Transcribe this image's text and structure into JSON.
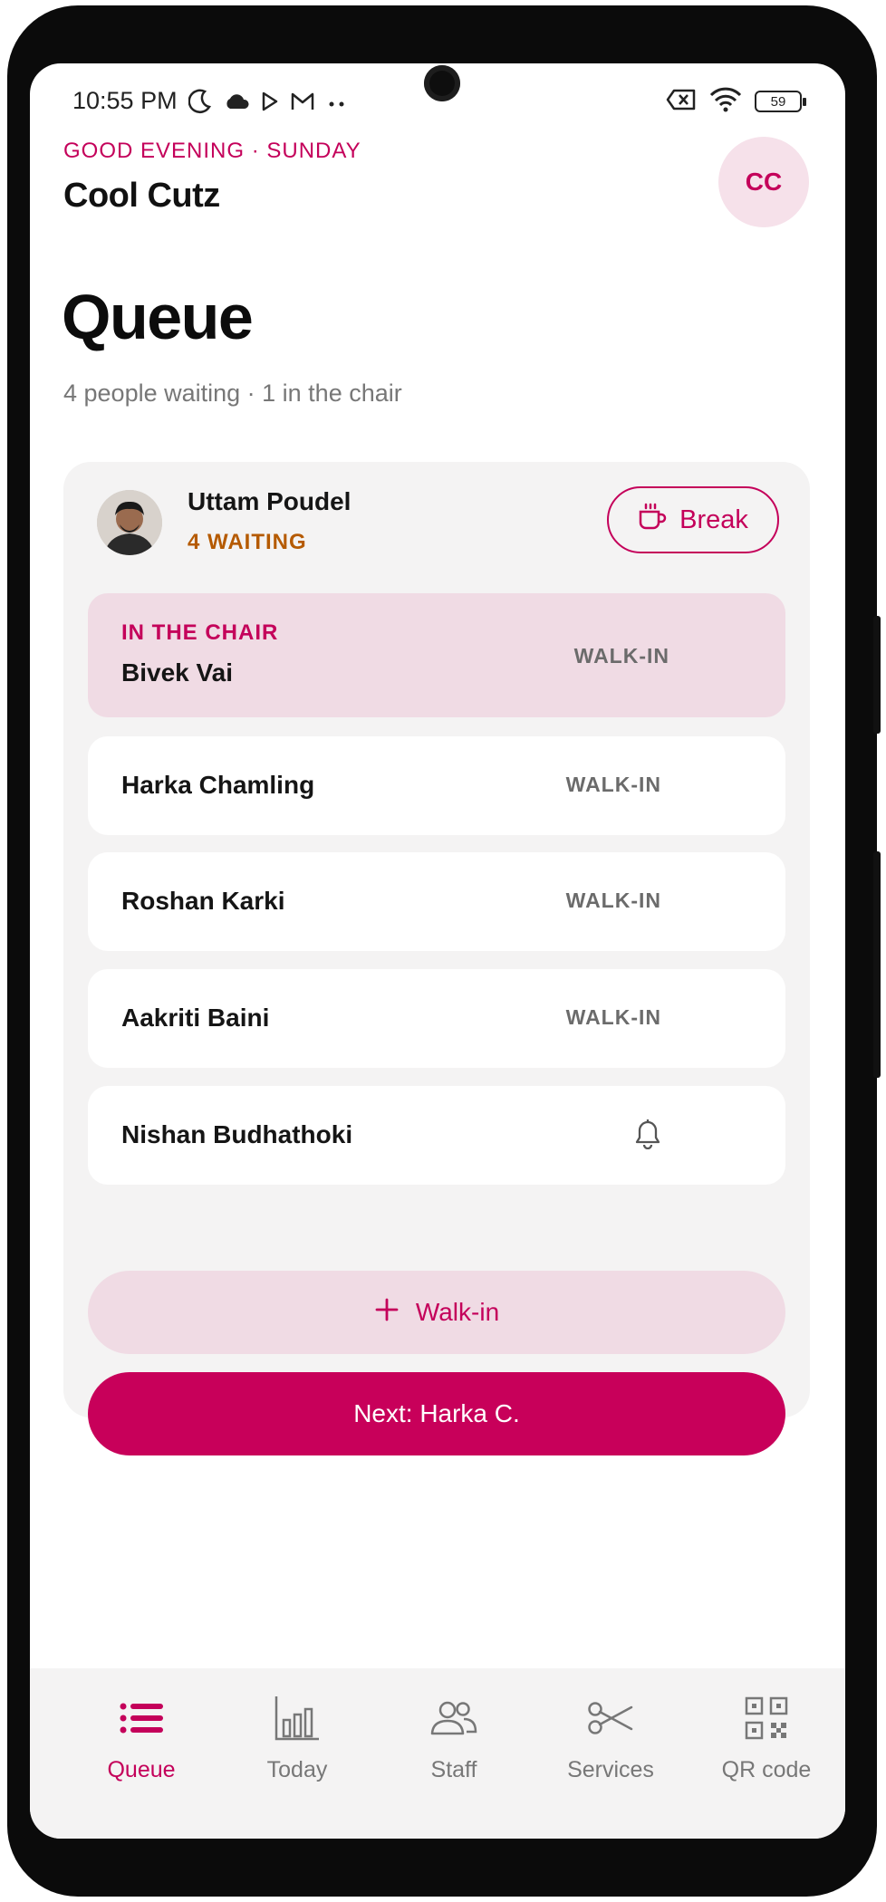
{
  "status_bar": {
    "time": "10:55 PM",
    "battery": "59",
    "icons_left": [
      "moon-icon",
      "cloud-icon",
      "play-store-icon",
      "gmail-icon",
      "more-dots-icon"
    ],
    "icons_right": [
      "sim-off-icon",
      "wifi-icon",
      "battery-icon"
    ]
  },
  "header": {
    "greeting": "GOOD EVENING · SUNDAY",
    "shop_name": "Cool Cutz",
    "avatar_initials": "CC"
  },
  "page": {
    "title": "Queue",
    "subtitle": "4 people waiting · 1 in the chair"
  },
  "barber": {
    "name": "Uttam Poudel",
    "waiting": "4 WAITING",
    "break_label": "Break"
  },
  "queue": {
    "chair_label": "IN THE CHAIR",
    "in_chair": {
      "name": "Bivek Vai",
      "tag": "WALK-IN"
    },
    "waiting": [
      {
        "name": "Harka Chamling",
        "tag": "WALK-IN"
      },
      {
        "name": "Roshan Karki",
        "tag": "WALK-IN"
      },
      {
        "name": "Aakriti Baini",
        "tag": "WALK-IN"
      },
      {
        "name": "Nishan Budhathoki",
        "tag": "",
        "icon": "bell-icon"
      }
    ]
  },
  "actions": {
    "walkin_label": "Walk-in",
    "next_label": "Next: Harka C."
  },
  "nav": {
    "items": [
      {
        "label": "Queue",
        "icon": "list-icon",
        "active": true
      },
      {
        "label": "Today",
        "icon": "bar-chart-icon",
        "active": false
      },
      {
        "label": "Staff",
        "icon": "people-icon",
        "active": false
      },
      {
        "label": "Services",
        "icon": "scissors-icon",
        "active": false
      },
      {
        "label": "QR code",
        "icon": "qr-code-icon",
        "active": false
      }
    ]
  },
  "colors": {
    "accent": "#c4005a",
    "accent_soft": "#f0dbe4",
    "waiting_count": "#b55a00",
    "card_bg": "#f4f3f3"
  }
}
